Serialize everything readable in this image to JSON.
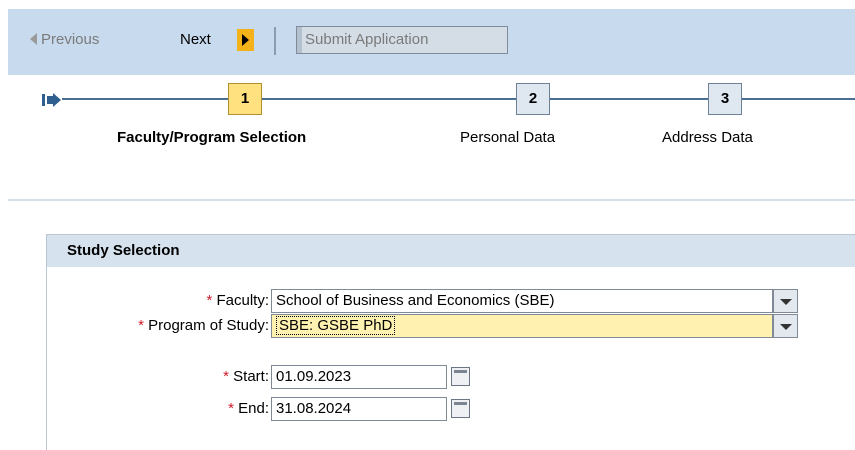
{
  "toolbar": {
    "previous_label": "Previous",
    "next_label": "Next",
    "submit_label": "Submit Application"
  },
  "roadmap": {
    "steps": [
      {
        "number": "1",
        "label": "Faculty/Program Selection",
        "active": true
      },
      {
        "number": "2",
        "label": "Personal Data",
        "active": false
      },
      {
        "number": "3",
        "label": "Address Data",
        "active": false
      }
    ]
  },
  "panel": {
    "title": "Study Selection",
    "required_marker": "*",
    "faculty": {
      "label": "Faculty:",
      "value": "School of Business and Economics (SBE)"
    },
    "program": {
      "label": "Program of Study:",
      "value": "SBE: GSBE PhD"
    },
    "start": {
      "label": "Start:",
      "value": "01.09.2023"
    },
    "end": {
      "label": "End:",
      "value": "31.08.2024"
    }
  },
  "colors": {
    "toolbar_bg": "#c8dbee",
    "active_step": "#ffe17f",
    "next_arrow": "#f3b21a",
    "required": "#d11c2a",
    "highlight_field": "#fff2b0"
  }
}
